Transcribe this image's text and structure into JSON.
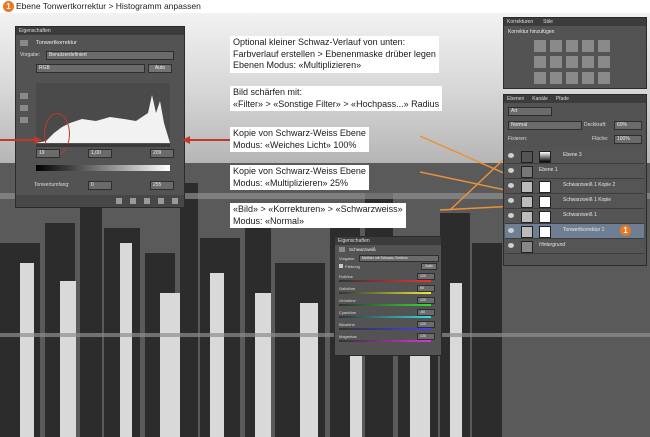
{
  "header": {
    "step": "1",
    "title": "Ebene Tonwertkorrektur > Histogramm anpassen"
  },
  "properties_panel": {
    "tab": "Eigenschaften",
    "title": "Tonwertkorrektur",
    "preset_label": "Vorgabe:",
    "preset_value": "Benutzerdefiniert",
    "channel": "RGB",
    "auto": "Auto",
    "input_black": "19",
    "input_gamma": "1,00",
    "input_white": "209",
    "output_label": "Tonwertumfang:",
    "output_black": "0",
    "output_white": "255"
  },
  "corrections_panel": {
    "tab_active": "Korrekturen",
    "tab_other": "Stile",
    "subtitle": "Korrektur hinzufügen"
  },
  "layers_panel": {
    "tabs": [
      "Ebenen",
      "Kanäle",
      "Pfade"
    ],
    "kind": "Art",
    "blend_mode": "Normal",
    "opacity_label": "Deckkraft:",
    "opacity_value": "60%",
    "lock_label": "Fixieren:",
    "fill_label": "Fläche:",
    "fill_value": "100%",
    "layers": [
      {
        "name": "Ebene 3"
      },
      {
        "name": "Ebene 1"
      },
      {
        "name": "Schwarzweiß 1 Kopie 2"
      },
      {
        "name": "Schwarzweiß 1 Kopie"
      },
      {
        "name": "Schwarzweiß 1"
      },
      {
        "name": "Tonwertkorrektur 1",
        "badge": "1"
      },
      {
        "name": "Hintergrund"
      }
    ]
  },
  "bw_panel": {
    "tab": "Eigenschaften",
    "title": "Schwarzweiß",
    "preset_label": "Vorgabe:",
    "preset_value": "Maßiter mit Schwarz-Tonform",
    "tint_label": "Färbung",
    "auto": "Auto",
    "sliders": [
      {
        "label": "Rottöne",
        "value": "120"
      },
      {
        "label": "Gelbtöne",
        "value": "60"
      },
      {
        "label": "Grüntöne",
        "value": "120"
      },
      {
        "label": "Cyantöne",
        "value": "-50"
      },
      {
        "label": "Blautöne",
        "value": "120"
      },
      {
        "label": "Magentas",
        "value": "120"
      }
    ]
  },
  "notes": {
    "n1": [
      "Optional kleiner Schwaz-Verlauf von unten:",
      "Farbverlauf erstellen > Ebenenmaske drüber legen",
      "Ebenen Modus: «Multiplizieren»"
    ],
    "n2": [
      "Bild schärfen mit:",
      "«Filter» > «Sonstige Filter» > «Hochpass...» Radius"
    ],
    "n3": [
      "Kopie von Schwarz-Weiss Ebene",
      "Modus: «Weiches Licht»  100%"
    ],
    "n4": [
      "Kopie von Schwarz-Weiss Ebene",
      "Modus: «Multiplizieren»  25%"
    ],
    "n5": [
      "«Bild» > «Korrekturen» > «Schwarzweiss»",
      "Modus: «Normal»"
    ]
  },
  "colors": {
    "badge": "#e87722",
    "arrow_red": "#c0392b",
    "arrow_orange": "#e8923a",
    "panel": "#535353",
    "panel_dark": "#3c3c3c"
  }
}
